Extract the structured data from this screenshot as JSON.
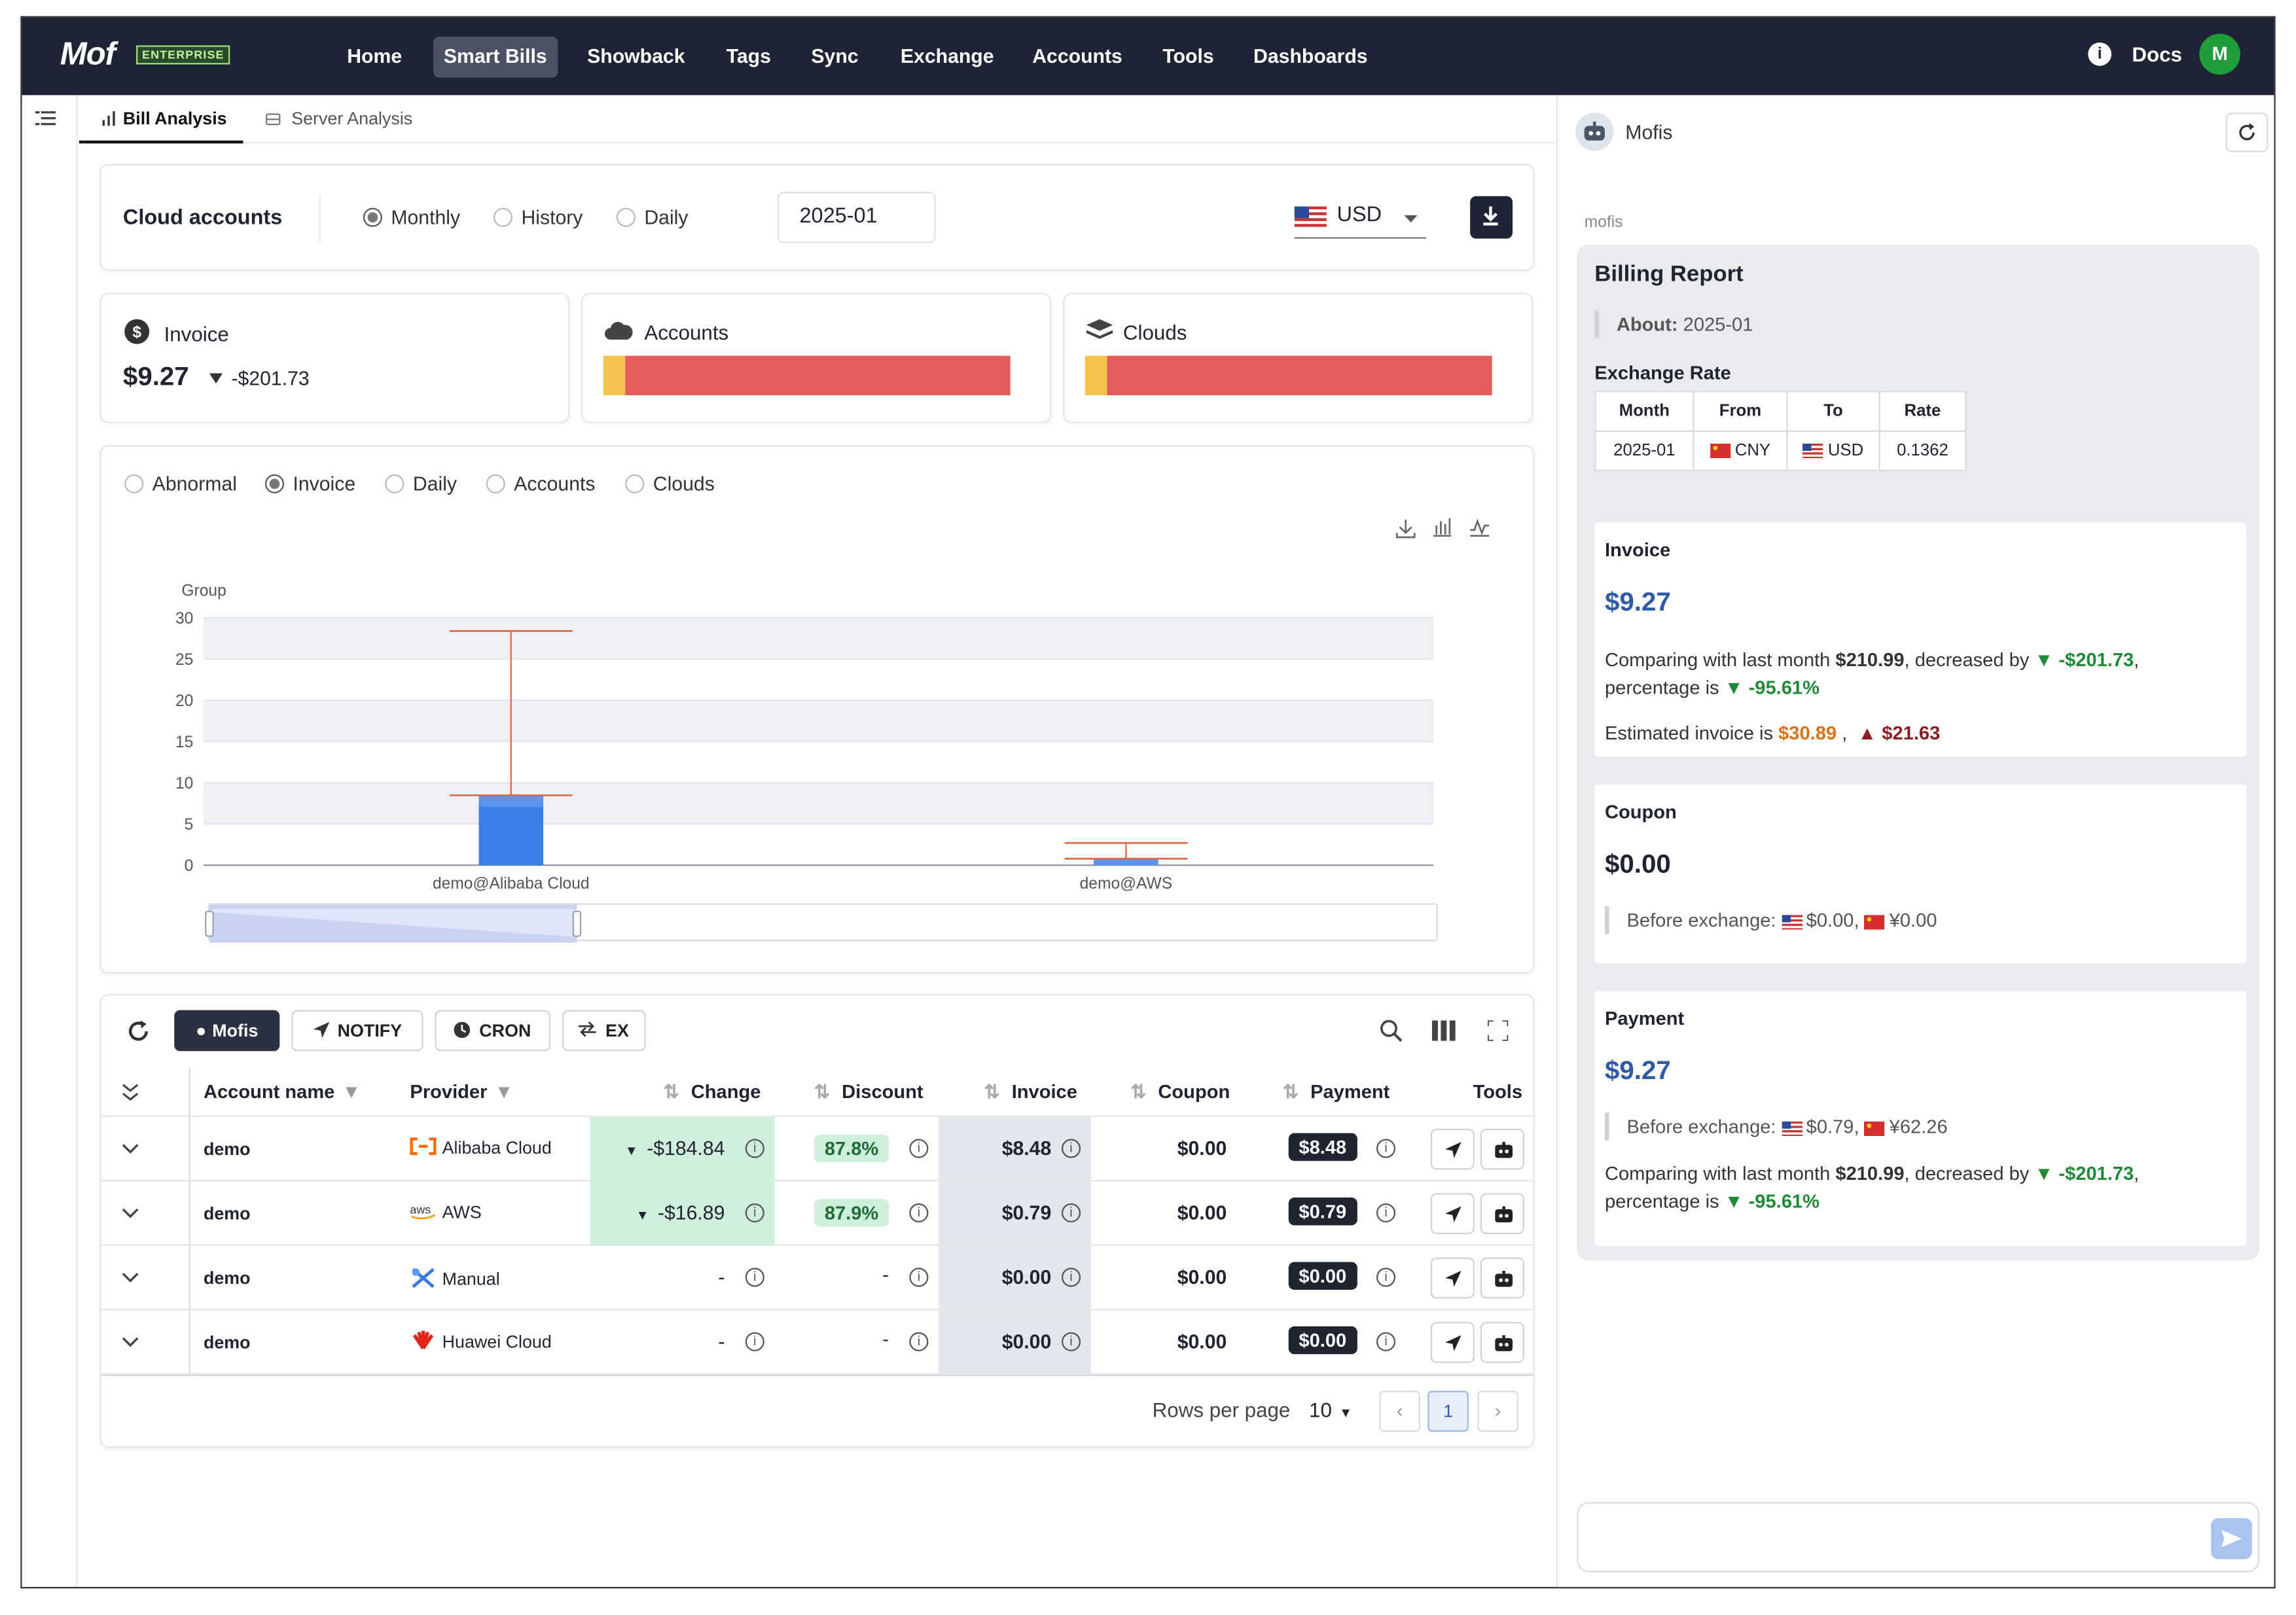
{
  "app": {
    "logo": "Mof",
    "edition": "ENTERPRISE",
    "docs": "Docs",
    "avatar": "M"
  },
  "nav": [
    "Home",
    "Smart Bills",
    "Showback",
    "Tags",
    "Sync",
    "Exchange",
    "Accounts",
    "Tools",
    "Dashboards"
  ],
  "nav_active": "Smart Bills",
  "tabs": {
    "bill": "Bill Analysis",
    "server": "Server Analysis"
  },
  "filter": {
    "title": "Cloud accounts",
    "monthly": "Monthly",
    "history": "History",
    "daily": "Daily",
    "month": "2025-01",
    "currency": "USD"
  },
  "summary": {
    "invoice_label": "Invoice",
    "invoice_value": "$9.27",
    "invoice_delta": "-$201.73",
    "accounts_label": "Accounts",
    "accounts_share": [
      0.055,
      0.945
    ],
    "clouds_label": "Clouds",
    "clouds_share": [
      0.055,
      0.945
    ],
    "bar_colors": [
      "#f2c14e",
      "#e05d5a"
    ]
  },
  "chart_tabs": [
    "Abnormal",
    "Invoice",
    "Daily",
    "Accounts",
    "Clouds"
  ],
  "chart_tab_active": "Invoice",
  "chart_data": {
    "type": "boxplot",
    "ylabel": "Group",
    "yticks": [
      "30",
      "25",
      "20",
      "15",
      "10",
      "5",
      "0"
    ],
    "ylim": [
      0,
      30
    ],
    "categories": [
      "demo@Alibaba Cloud",
      "demo@AWS"
    ],
    "boxes": [
      {
        "name": "demo@Alibaba Cloud",
        "min": 0,
        "q1": 0,
        "median": 8.48,
        "q3": 8.48,
        "max": 28.4
      },
      {
        "name": "demo@AWS",
        "min": 0,
        "q1": 0,
        "median": 0.79,
        "q3": 0.79,
        "max": 2.7
      }
    ],
    "grid": true
  },
  "toolbar": {
    "mofis": "Mofis",
    "notify": "NOTIFY",
    "cron": "CRON",
    "ex": "EX"
  },
  "table": {
    "headers": {
      "account": "Account name",
      "provider": "Provider",
      "change": "Change",
      "discount": "Discount",
      "invoice": "Invoice",
      "coupon": "Coupon",
      "payment": "Payment",
      "tools": "Tools"
    },
    "rows": [
      {
        "account": "demo",
        "provider": "Alibaba Cloud",
        "change": "-$184.84",
        "discount": "87.8%",
        "invoice": "$8.48",
        "coupon": "$0.00",
        "payment": "$8.48"
      },
      {
        "account": "demo",
        "provider": "AWS",
        "change": "-$16.89",
        "discount": "87.9%",
        "invoice": "$0.79",
        "coupon": "$0.00",
        "payment": "$0.79"
      },
      {
        "account": "demo",
        "provider": "Manual",
        "change": "-",
        "discount": "-",
        "invoice": "$0.00",
        "coupon": "$0.00",
        "payment": "$0.00"
      },
      {
        "account": "demo",
        "provider": "Huawei Cloud",
        "change": "-",
        "discount": "-",
        "invoice": "$0.00",
        "coupon": "$0.00",
        "payment": "$0.00"
      }
    ],
    "rows_per_page_label": "Rows per page",
    "rows_per_page": "10",
    "page": "1"
  },
  "assistant": {
    "name": "Mofis",
    "sender": "mofis",
    "report_title": "Billing Report",
    "about_label": "About:",
    "about_value": "2025-01",
    "exchange_title": "Exchange Rate",
    "exchange_headers": [
      "Month",
      "From",
      "To",
      "Rate"
    ],
    "exchange_row": {
      "month": "2025-01",
      "from": "CNY",
      "to": "USD",
      "rate": "0.1362"
    },
    "invoice": {
      "title": "Invoice",
      "value": "$9.27",
      "compare_pre": "Comparing with last month",
      "last_month": "$210.99",
      "decreased_by": ",   decreased by",
      "delta": "-$201.73",
      "pct_pre": ",  percentage is",
      "pct": "-95.61%",
      "est_pre": "Estimated invoice is",
      "est": "$30.89",
      "est_delta": "$21.63"
    },
    "coupon": {
      "title": "Coupon",
      "value": "$0.00",
      "before_label": "Before exchange:",
      "usd": "$0.00",
      "cny": "¥0.00"
    },
    "payment": {
      "title": "Payment",
      "value": "$9.27",
      "before_label": "Before exchange:",
      "usd": "$0.79",
      "cny": "¥62.26",
      "compare_pre": "Comparing with last month",
      "last_month": "$210.99",
      "decreased_by": ",   decreased by",
      "delta": "-$201.73",
      "pct_pre": ",  percentage is",
      "pct": "-95.61%"
    }
  }
}
